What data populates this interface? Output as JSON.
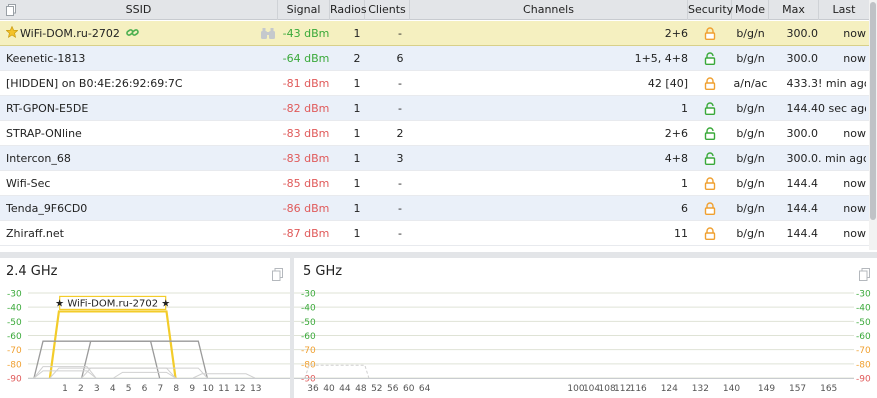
{
  "table": {
    "headers": {
      "ssid": "SSID",
      "signal": "Signal",
      "radios": "Radios",
      "clients": "Clients",
      "channels": "Channels",
      "security": "Security",
      "mode": "Mode",
      "max_rate": "Max Rate",
      "last_seen": "Last Seen"
    },
    "rows": [
      {
        "ssid": "WiFi-DOM.ru-2702",
        "signal": "-43 dBm",
        "radios": "1",
        "clients": "-",
        "channels": "2+6",
        "security": "lock-closed",
        "mode": "b/g/n",
        "max_rate": "300.0",
        "last_seen": "now",
        "favorite": true
      },
      {
        "ssid": "Keenetic-1813",
        "signal": "-64 dBm",
        "radios": "2",
        "clients": "6",
        "channels": "1+5, 4+8",
        "security": "lock-open",
        "mode": "b/g/n",
        "max_rate": "300.0",
        "last_seen": "now"
      },
      {
        "ssid": "[HIDDEN] on B0:4E:26:92:69:7C",
        "signal": "-81 dBm",
        "radios": "1",
        "clients": "-",
        "channels": "42 [40]",
        "security": "lock-closed",
        "mode": "a/n/ac",
        "max_rate": "433.3",
        "last_seen": "! min ago"
      },
      {
        "ssid": "RT-GPON-E5DE",
        "signal": "-82 dBm",
        "radios": "1",
        "clients": "-",
        "channels": "1",
        "security": "lock-open",
        "mode": "b/g/n",
        "max_rate": "144.4",
        "last_seen": "0 sec ago"
      },
      {
        "ssid": "STRAP-ONline",
        "signal": "-83 dBm",
        "radios": "1",
        "clients": "2",
        "channels": "2+6",
        "security": "lock-open",
        "mode": "b/g/n",
        "max_rate": "300.0",
        "last_seen": "now"
      },
      {
        "ssid": "Intercon_68",
        "signal": "-83 dBm",
        "radios": "1",
        "clients": "3",
        "channels": "4+8",
        "security": "lock-open",
        "mode": "b/g/n",
        "max_rate": "300.0",
        "last_seen": ". min ago"
      },
      {
        "ssid": "Wifi-Sec",
        "signal": "-85 dBm",
        "radios": "1",
        "clients": "-",
        "channels": "1",
        "security": "lock-closed",
        "mode": "b/g/n",
        "max_rate": "144.4",
        "last_seen": "now"
      },
      {
        "ssid": "Tenda_9F6CD0",
        "signal": "-86 dBm",
        "radios": "1",
        "clients": "-",
        "channels": "6",
        "security": "lock-closed",
        "mode": "b/g/n",
        "max_rate": "144.4",
        "last_seen": "now"
      },
      {
        "ssid": "Zhiraff.net",
        "signal": "-87 dBm",
        "radios": "1",
        "clients": "-",
        "channels": "11",
        "security": "lock-closed",
        "mode": "b/g/n",
        "max_rate": "144.4",
        "last_seen": "now"
      }
    ]
  },
  "colors": {
    "signal_good": "#3aa93a",
    "signal_weak": "#e05a5a",
    "selected_row": "#f5f0c0",
    "highlight_network": "#f3cc2a",
    "lock_closed": "#f0a030",
    "lock_open": "#3aa93a"
  },
  "chart_data": [
    {
      "type": "area",
      "title": "2.4 GHz",
      "y_ticks": [
        "-30",
        "-40",
        "-50",
        "-60",
        "-70",
        "-80",
        "-90"
      ],
      "ylim": [
        -90,
        -30
      ],
      "x_ticks": [
        "1",
        "2",
        "3",
        "4",
        "5",
        "6",
        "7",
        "8",
        "9",
        "10",
        "11",
        "12",
        "13"
      ],
      "highlight_label": "★ WiFi-DOM.ru-2702 ★",
      "series": [
        {
          "name": "WiFi-DOM.ru-2702",
          "channels": [
            2,
            6
          ],
          "signal": -43,
          "highlight": true
        },
        {
          "name": "Keenetic-1813",
          "channels": [
            1,
            5
          ],
          "signal": -64
        },
        {
          "name": "Keenetic-1813",
          "channels": [
            4,
            8
          ],
          "signal": -64
        },
        {
          "name": "RT-GPON-E5DE",
          "channels": [
            1,
            1
          ],
          "signal": -82
        },
        {
          "name": "STRAP-ONline",
          "channels": [
            2,
            6
          ],
          "signal": -83
        },
        {
          "name": "Intercon_68",
          "channels": [
            4,
            8
          ],
          "signal": -83
        },
        {
          "name": "Wifi-Sec",
          "channels": [
            1,
            1
          ],
          "signal": -85
        },
        {
          "name": "Tenda_9F6CD0",
          "channels": [
            6,
            6
          ],
          "signal": -86
        },
        {
          "name": "Zhiraff.net",
          "channels": [
            11,
            11
          ],
          "signal": -87
        }
      ]
    },
    {
      "type": "area",
      "title": "5 GHz",
      "y_ticks": [
        "-30",
        "-40",
        "-50",
        "-60",
        "-70",
        "-80",
        "-90"
      ],
      "ylim": [
        -90,
        -30
      ],
      "x_ticks": [
        "36",
        "40",
        "44",
        "48",
        "52",
        "56",
        "60",
        "64",
        "100",
        "104",
        "108",
        "112",
        "116",
        "124",
        "132",
        "140",
        "149",
        "157",
        "165"
      ],
      "series": [
        {
          "name": "[HIDDEN] on B0:4E:26:92:69:7C",
          "channels": [
            36,
            48
          ],
          "signal": -81
        }
      ]
    }
  ]
}
